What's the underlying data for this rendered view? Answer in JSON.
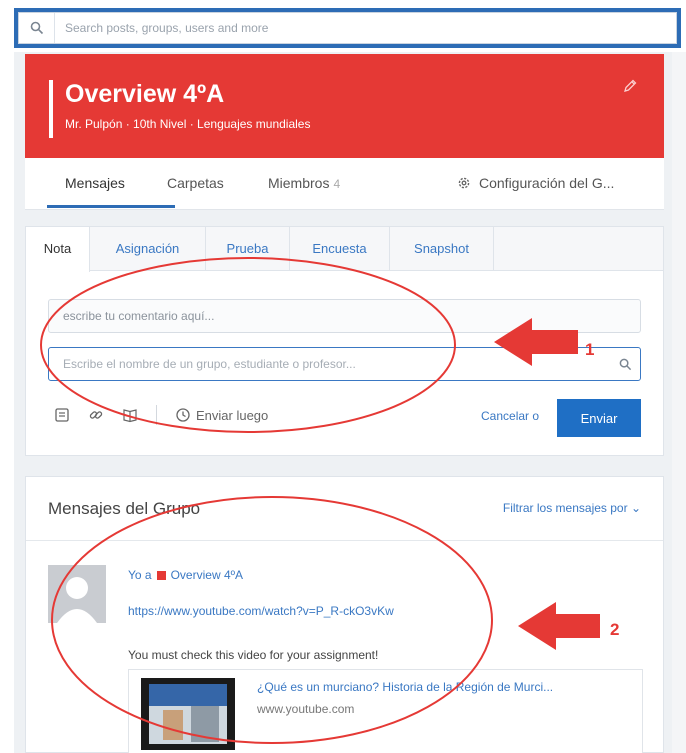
{
  "search": {
    "placeholder": "Search posts, groups, users and more"
  },
  "group": {
    "title": "Overview 4ºA",
    "subtitle": "Mr. Pulpón · 10th Nivel · Lenguajes mundiales"
  },
  "tabs": {
    "messages": "Mensajes",
    "folders": "Carpetas",
    "members": "Miembros",
    "members_count": "4",
    "settings": "Configuración del G..."
  },
  "composer": {
    "tabs": [
      "Nota",
      "Asignación",
      "Prueba",
      "Encuesta",
      "Snapshot"
    ],
    "comment_placeholder": "escribe tu comentario aquí...",
    "recipient_placeholder": "Escribe el nombre de un grupo, estudiante o profesor...",
    "send_later": "Enviar luego",
    "cancel": "Cancelar o",
    "send": "Enviar"
  },
  "messages": {
    "title": "Mensajes del Grupo",
    "filter": "Filtrar los mensajes por",
    "post": {
      "from": "Yo a",
      "group": "Overview 4ºA",
      "link": "https://www.youtube.com/watch?v=P_R-ckO3vKw",
      "text": "You must check this video for your assignment!",
      "preview_title": "¿Qué es un murciano? Historia de la Región de Murci...",
      "preview_domain": "www.youtube.com"
    }
  },
  "annotations": {
    "first": "1",
    "second": "2"
  },
  "colors": {
    "brand_red": "#e53935",
    "primary_blue": "#1f6fc5",
    "link_blue": "#3a78c3"
  }
}
